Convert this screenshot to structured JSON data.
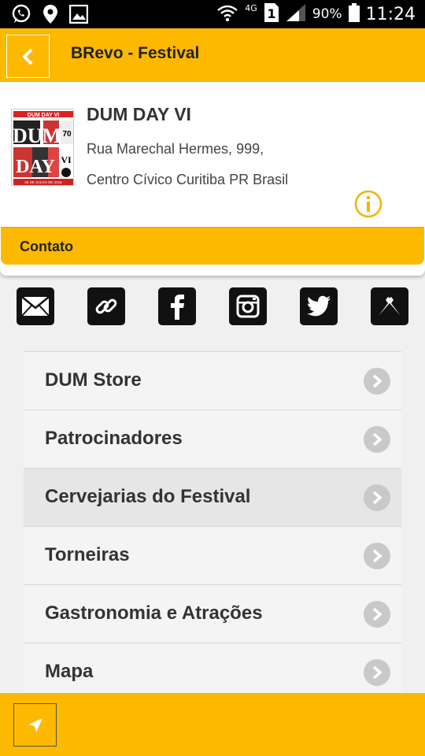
{
  "status_bar": {
    "network": "4G",
    "sim": "1",
    "battery": "90%",
    "time": "11:24",
    "icons": [
      "whatsapp-icon",
      "location-icon",
      "image-icon",
      "wifi-icon",
      "signal-icon",
      "battery-icon"
    ]
  },
  "header": {
    "title": "BRevo - Festival",
    "back_icon": "chevron-left-icon"
  },
  "event": {
    "name": "DUM DAY VI",
    "address_line1": "Rua Marechal Hermes, 999,",
    "address_line2": "Centro Cívico Curitiba PR Brasil",
    "contact_label": "Contato",
    "poster": {
      "top": "DUM DAY VI",
      "big1": "DUM",
      "big2": "DAY",
      "roman": "VI",
      "count": "70",
      "bottom": "05 DE JULHO DE 2015"
    }
  },
  "social": [
    "email-icon",
    "link-icon",
    "facebook-icon",
    "instagram-icon",
    "twitter-icon",
    "untappd-icon"
  ],
  "menu": {
    "items": [
      {
        "label": "DUM Store"
      },
      {
        "label": "Patrocinadores"
      },
      {
        "label": "Cervejarias do Festival"
      },
      {
        "label": "Torneiras"
      },
      {
        "label": "Gastronomia e Atrações"
      },
      {
        "label": "Mapa"
      }
    ]
  },
  "colors": {
    "accent": "#fdb900",
    "status_bar": "#000000",
    "background": "#f0f0f0"
  }
}
